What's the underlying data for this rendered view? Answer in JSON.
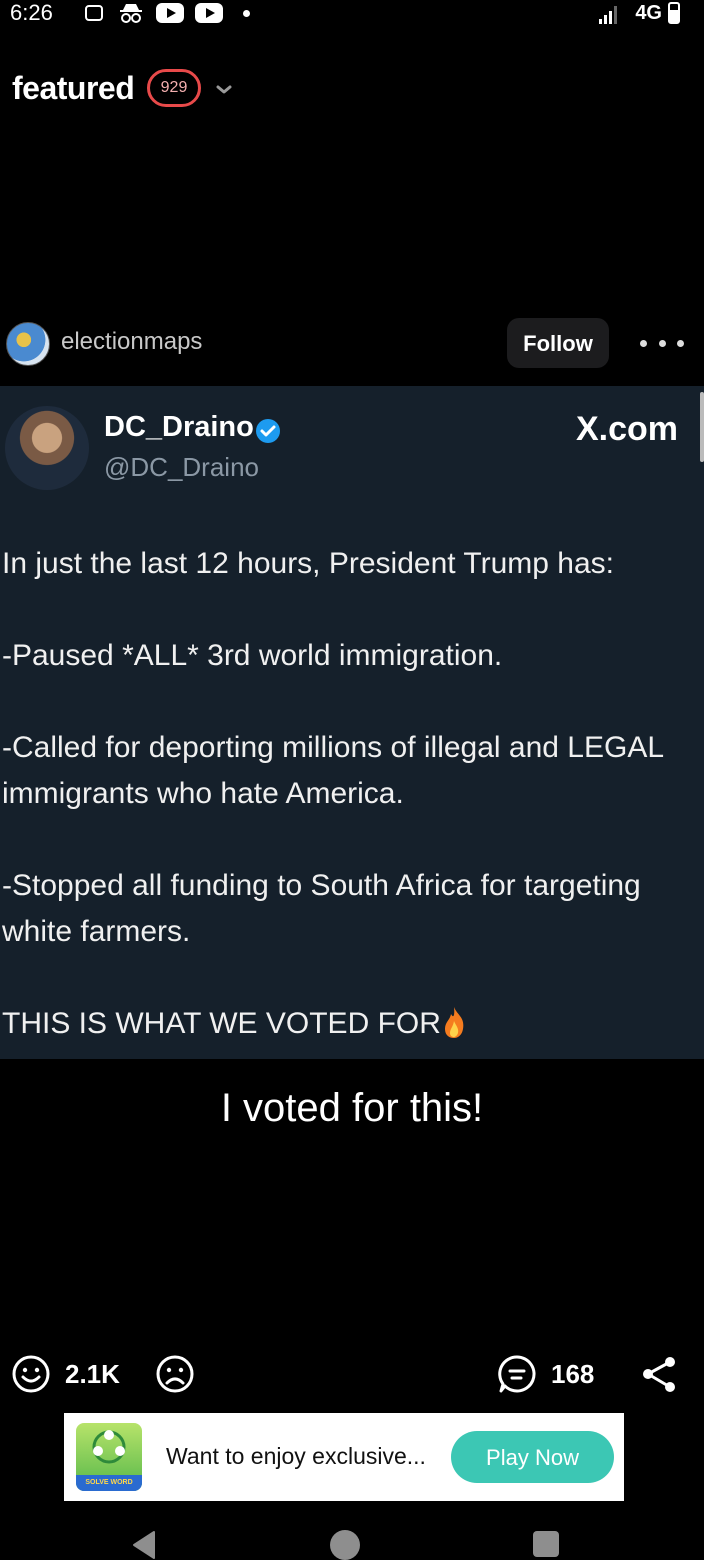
{
  "status_bar": {
    "time": "6:26",
    "network": "4G",
    "icons": [
      "notification-icon",
      "incognito-icon",
      "youtube-icon",
      "youtube-icon",
      "dot-icon",
      "signal-icon",
      "battery-icon"
    ]
  },
  "header": {
    "title": "featured",
    "count": "929"
  },
  "post": {
    "author": "electionmaps",
    "follow_label": "Follow",
    "tweet": {
      "name": "DC_Draino",
      "handle": "@DC_Draino",
      "source": "X.com",
      "body": "In just the last 12 hours, President Trump has:\n\n-Paused *ALL* 3rd world immigration.\n\n-Called for deporting millions of illegal and LEGAL immigrants who hate America.\n\n-Stopped all funding to South Africa for targeting white farmers.\n\nTHIS IS WHAT WE VOTED FOR"
    },
    "caption": "I voted for this!"
  },
  "actions": {
    "upvotes": "2.1K",
    "comments": "168"
  },
  "ad": {
    "image_caption": "SOLVE WORD PUZZLE",
    "text": "Want to enjoy exclusive...",
    "button": "Play Now"
  },
  "colors": {
    "tweet_bg": "#15202b",
    "badge": "#e84a4a",
    "play_button": "#3cc7b4",
    "verified": "#1d9bf0"
  }
}
